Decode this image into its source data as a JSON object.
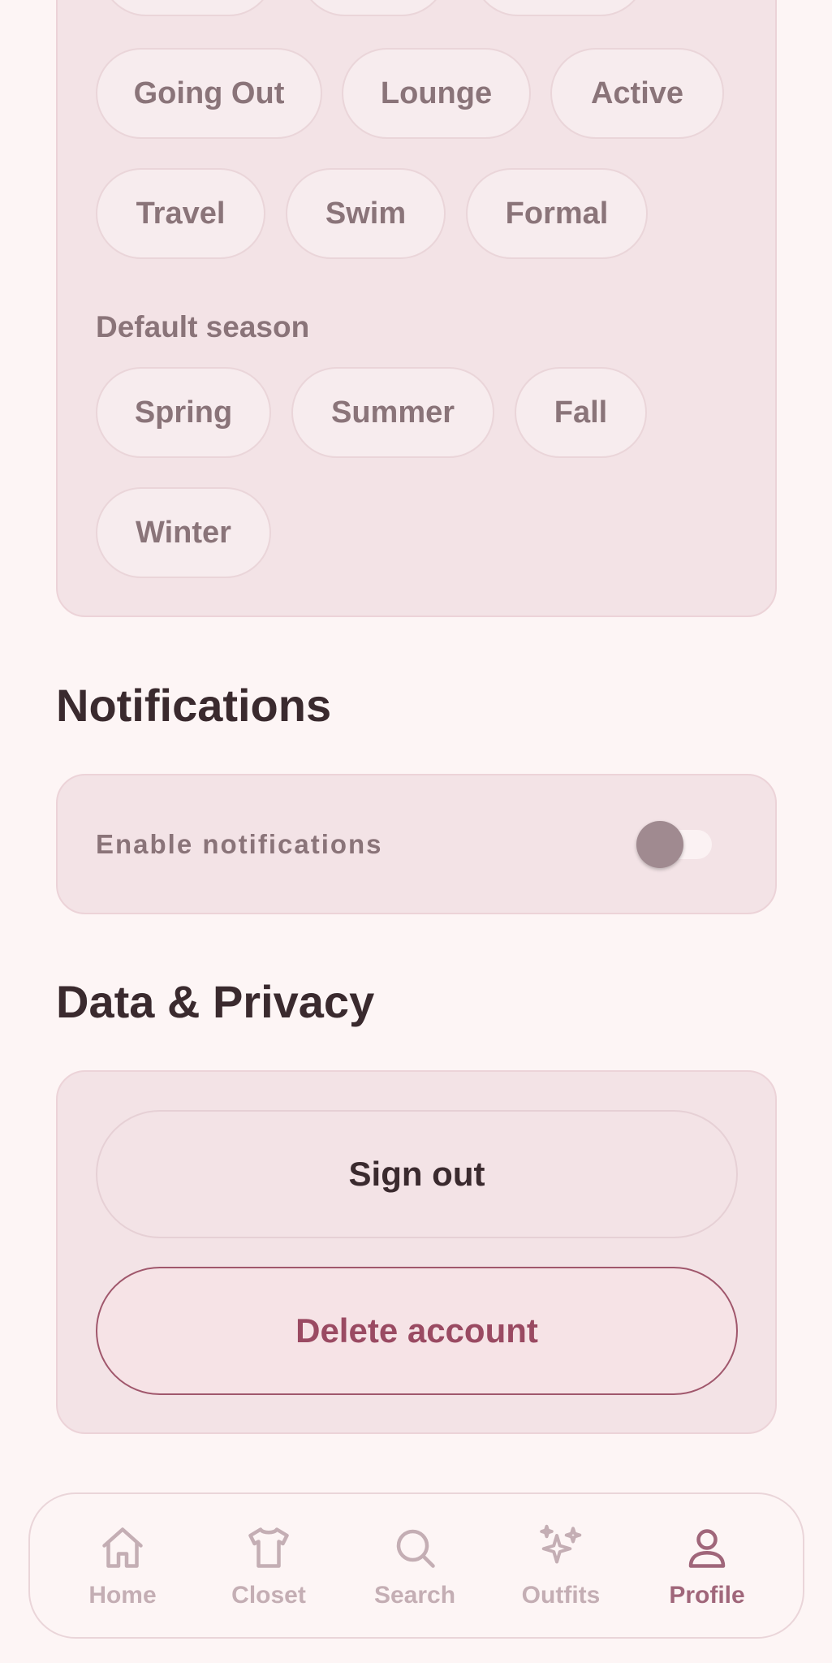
{
  "style_section": {
    "style_chips": [
      {
        "label": "Going Out"
      },
      {
        "label": "Lounge"
      },
      {
        "label": "Active"
      },
      {
        "label": "Travel"
      },
      {
        "label": "Swim"
      },
      {
        "label": "Formal"
      }
    ],
    "season_label": "Default season",
    "season_chips": [
      {
        "label": "Spring"
      },
      {
        "label": "Summer"
      },
      {
        "label": "Fall"
      },
      {
        "label": "Winter"
      }
    ]
  },
  "notifications": {
    "title": "Notifications",
    "enable_label": "Enable notifications",
    "enabled": false
  },
  "data_privacy": {
    "title": "Data & Privacy",
    "sign_out_label": "Sign out",
    "delete_account_label": "Delete account"
  },
  "nav": {
    "items": [
      {
        "label": "Home",
        "icon": "home-icon"
      },
      {
        "label": "Closet",
        "icon": "shirt-icon"
      },
      {
        "label": "Search",
        "icon": "search-icon"
      },
      {
        "label": "Outfits",
        "icon": "sparkles-icon"
      },
      {
        "label": "Profile",
        "icon": "person-icon"
      }
    ],
    "active": "Profile"
  },
  "colors": {
    "background": "#fdf5f5",
    "card": "#f3e3e6",
    "accent": "#a0667a",
    "danger": "#9a4a62"
  }
}
